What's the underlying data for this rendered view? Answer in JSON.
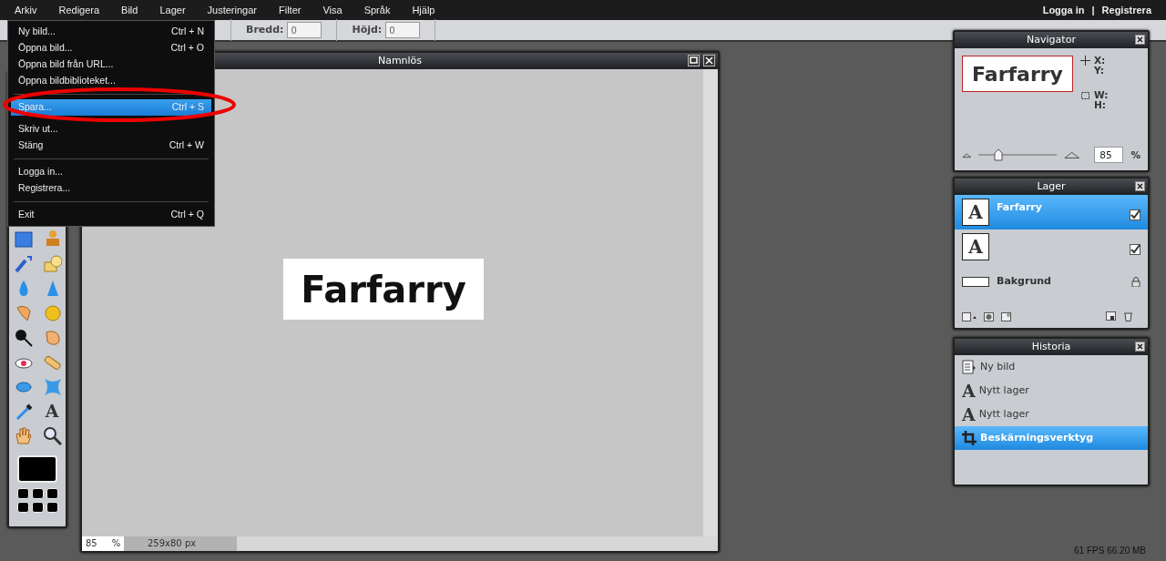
{
  "menubar": {
    "items": [
      {
        "label": "Arkiv"
      },
      {
        "label": "Redigera"
      },
      {
        "label": "Bild"
      },
      {
        "label": "Lager"
      },
      {
        "label": "Justeringar"
      },
      {
        "label": "Filter"
      },
      {
        "label": "Visa"
      },
      {
        "label": "Språk"
      },
      {
        "label": "Hjälp"
      }
    ],
    "account_links": [
      "Logga in",
      "Registrera"
    ],
    "account_separator": "|"
  },
  "toolbar": {
    "fields": [
      {
        "label": "Bredd:",
        "value": "0"
      },
      {
        "label": "Höjd:",
        "value": "0"
      }
    ]
  },
  "file_menu": {
    "items": [
      {
        "kind": "item",
        "label": "Ny bild...",
        "shortcut": "Ctrl + N",
        "selected": false
      },
      {
        "kind": "item",
        "label": "Öppna bild...",
        "shortcut": "Ctrl + O",
        "selected": false
      },
      {
        "kind": "item",
        "label": "Öppna bild från URL...",
        "selected": false
      },
      {
        "kind": "item",
        "label": "Öppna bildbiblioteket...",
        "selected": false
      },
      {
        "kind": "separator"
      },
      {
        "kind": "item",
        "label": "Spara...",
        "shortcut": "Ctrl + S",
        "selected": true
      },
      {
        "kind": "item",
        "label": "Skriv ut...",
        "selected": false
      },
      {
        "kind": "item",
        "label": "Stäng",
        "shortcut": "Ctrl + W",
        "selected": false
      },
      {
        "kind": "separator"
      },
      {
        "kind": "item",
        "label": "Logga in...",
        "selected": false
      },
      {
        "kind": "item",
        "label": "Registrera...",
        "selected": false
      },
      {
        "kind": "separator"
      },
      {
        "kind": "item",
        "label": "Exit",
        "shortcut": "Ctrl + Q",
        "selected": false
      }
    ]
  },
  "toolbox": {
    "text_tool_glyph": "A"
  },
  "canvas_window": {
    "title": "Namnlös",
    "image_text": "Farfarry",
    "zoom": "85",
    "zoom_unit": "%",
    "size": "259x80 px"
  },
  "navigator": {
    "title": "Navigator",
    "preview_text": "Farfarry",
    "position_labels": [
      "X:",
      "Y:"
    ],
    "size_labels": [
      "W:",
      "H:"
    ],
    "zoom": {
      "level": 0.25,
      "value": "85",
      "unit": "%"
    }
  },
  "layers": {
    "title": "Lager",
    "items": [
      {
        "kind": "text",
        "glyph": "A",
        "name": "Farfarry",
        "selected": true,
        "locked": false,
        "visible": true
      },
      {
        "kind": "text",
        "glyph": "A",
        "selected": false,
        "locked": false,
        "visible": true
      },
      {
        "kind": "fill",
        "name": "Bakgrund",
        "selected": false,
        "locked": true
      }
    ]
  },
  "history": {
    "title": "Historia",
    "items": [
      {
        "kind": "document",
        "label": "Ny bild",
        "selected": false
      },
      {
        "kind": "text",
        "glyph": "A",
        "label": "Nytt lager",
        "selected": false
      },
      {
        "kind": "text",
        "glyph": "A",
        "label": "Nytt lager",
        "selected": false
      },
      {
        "kind": "crop",
        "label": "Beskärningsverktyg",
        "selected": true
      }
    ]
  },
  "status": "61 FPS 66.20 MB"
}
